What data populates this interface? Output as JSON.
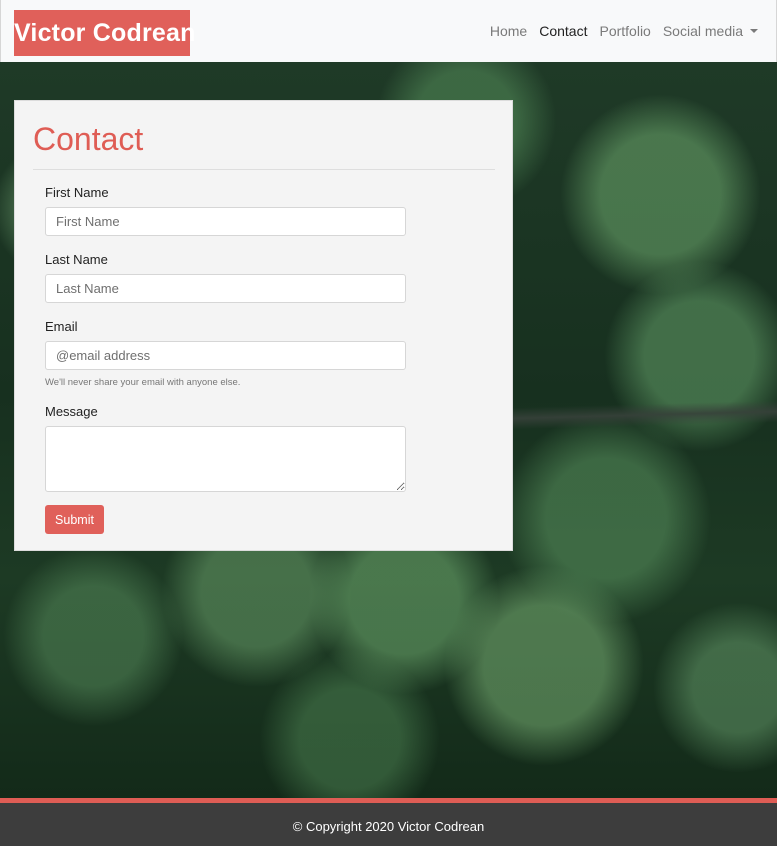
{
  "brand": {
    "name": "Victor Codrean"
  },
  "nav": {
    "items": [
      {
        "label": "Home",
        "active": false
      },
      {
        "label": "Contact",
        "active": true
      },
      {
        "label": "Portfolio",
        "active": false
      },
      {
        "label": "Social media",
        "active": false,
        "dropdown": true
      }
    ]
  },
  "form": {
    "title": "Contact",
    "first_name": {
      "label": "First Name",
      "placeholder": "First Name",
      "value": ""
    },
    "last_name": {
      "label": "Last Name",
      "placeholder": "Last Name",
      "value": ""
    },
    "email": {
      "label": "Email",
      "placeholder": "@email address",
      "value": "",
      "help": "We'll never share your email with anyone else."
    },
    "message": {
      "label": "Message",
      "value": ""
    },
    "submit_label": "Submit"
  },
  "footer": {
    "text": "© Copyright 2020 Victor Codrean"
  },
  "colors": {
    "accent": "#e0605a",
    "navbar_bg": "#f8f9fa",
    "footer_bg": "#3d3d3d"
  },
  "icons": {
    "dropdown": "chevron-down-icon"
  }
}
